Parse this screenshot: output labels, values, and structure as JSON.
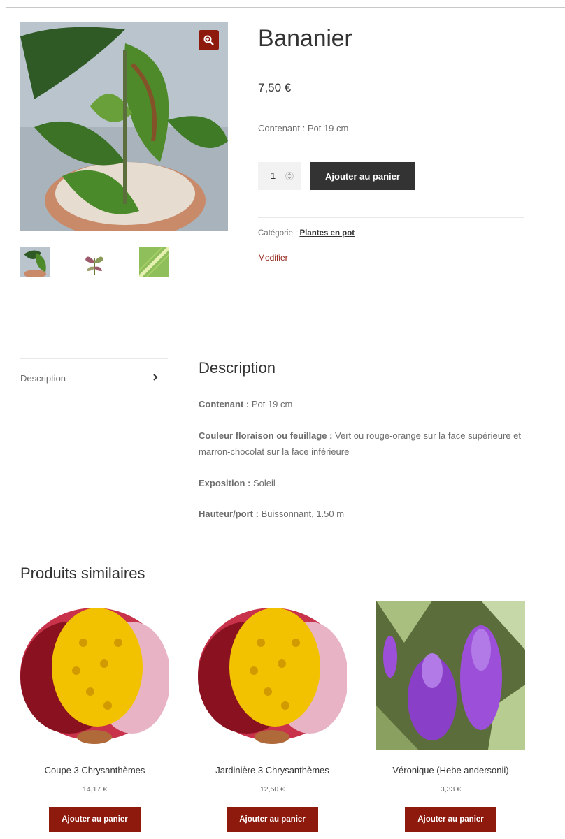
{
  "product": {
    "title": "Bananier",
    "price": "7,50 €",
    "short_description": "Contenant : Pot 19 cm",
    "quantity": "1",
    "add_to_cart_label": "Ajouter au panier",
    "category_label": "Catégorie : ",
    "category_link": "Plantes en pot",
    "edit_link": "Modifier"
  },
  "gallery": {
    "zoom_icon": "zoom-in-icon",
    "thumbnails": [
      "Bananier vue 1",
      "Bananier vue 2",
      "Bananier vue 3"
    ]
  },
  "tabs": {
    "items": [
      {
        "label": "Description"
      }
    ]
  },
  "description": {
    "heading": "Description",
    "rows": [
      {
        "label": "Contenant :",
        "value": " Pot 19 cm"
      },
      {
        "label": "Couleur floraison ou feuillage :",
        "value": " Vert ou rouge-orange sur la face supérieure et marron-chocolat sur la face inférieure"
      },
      {
        "label": "Exposition :",
        "value": " Soleil"
      },
      {
        "label": "Hauteur/port :",
        "value": " Buissonnant, 1.50 m"
      }
    ]
  },
  "related": {
    "heading": "Produits similaires",
    "products": [
      {
        "name": "Coupe 3 Chrysanthèmes",
        "price": "14,17 €",
        "button": "Ajouter au panier"
      },
      {
        "name": "Jardinière 3 Chrysanthèmes",
        "price": "12,50 €",
        "button": "Ajouter au panier"
      },
      {
        "name": "Véronique (Hebe andersonii)",
        "price": "3,33 €",
        "button": "Ajouter au panier"
      }
    ]
  },
  "colors": {
    "accent": "#8e1a0e",
    "dark_button": "#333333",
    "text": "#6d6d6d",
    "heading": "#333333"
  }
}
